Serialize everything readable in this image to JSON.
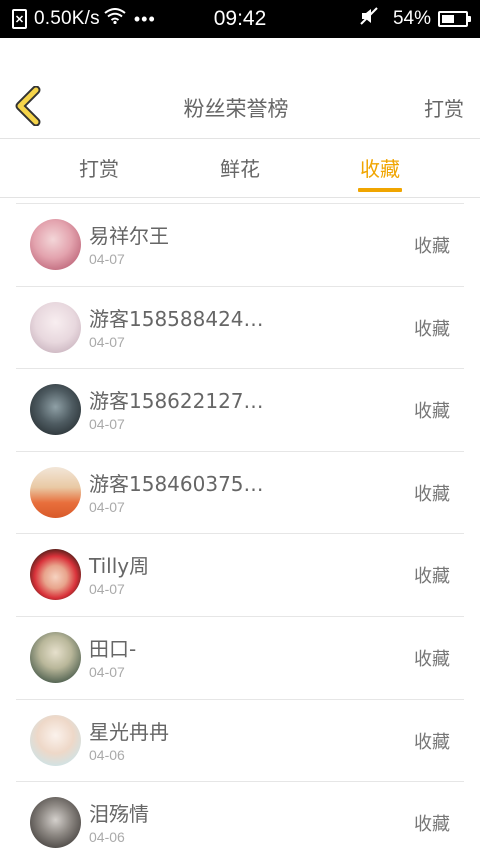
{
  "status_bar": {
    "speed": "0.50K/s",
    "time": "09:42",
    "battery": "54%",
    "battery_level": 0.54
  },
  "header": {
    "title": "粉丝荣誉榜",
    "right_action": "打赏"
  },
  "tabs": [
    {
      "label": "打赏",
      "active": false
    },
    {
      "label": "鲜花",
      "active": false
    },
    {
      "label": "收藏",
      "active": true
    }
  ],
  "accent_color": "#f0a500",
  "rows": [
    {
      "name": "易祥尔王",
      "date": "04-07",
      "action": "收藏"
    },
    {
      "name": "游客158588424…",
      "date": "04-07",
      "action": "收藏"
    },
    {
      "name": "游客158622127…",
      "date": "04-07",
      "action": "收藏"
    },
    {
      "name": "游客158460375…",
      "date": "04-07",
      "action": "收藏"
    },
    {
      "name": "Tilly周",
      "date": "04-07",
      "action": "收藏"
    },
    {
      "name": "田口-",
      "date": "04-07",
      "action": "收藏"
    },
    {
      "name": "星光冉冉",
      "date": "04-06",
      "action": "收藏"
    },
    {
      "name": "泪殇情",
      "date": "04-06",
      "action": "收藏"
    }
  ]
}
